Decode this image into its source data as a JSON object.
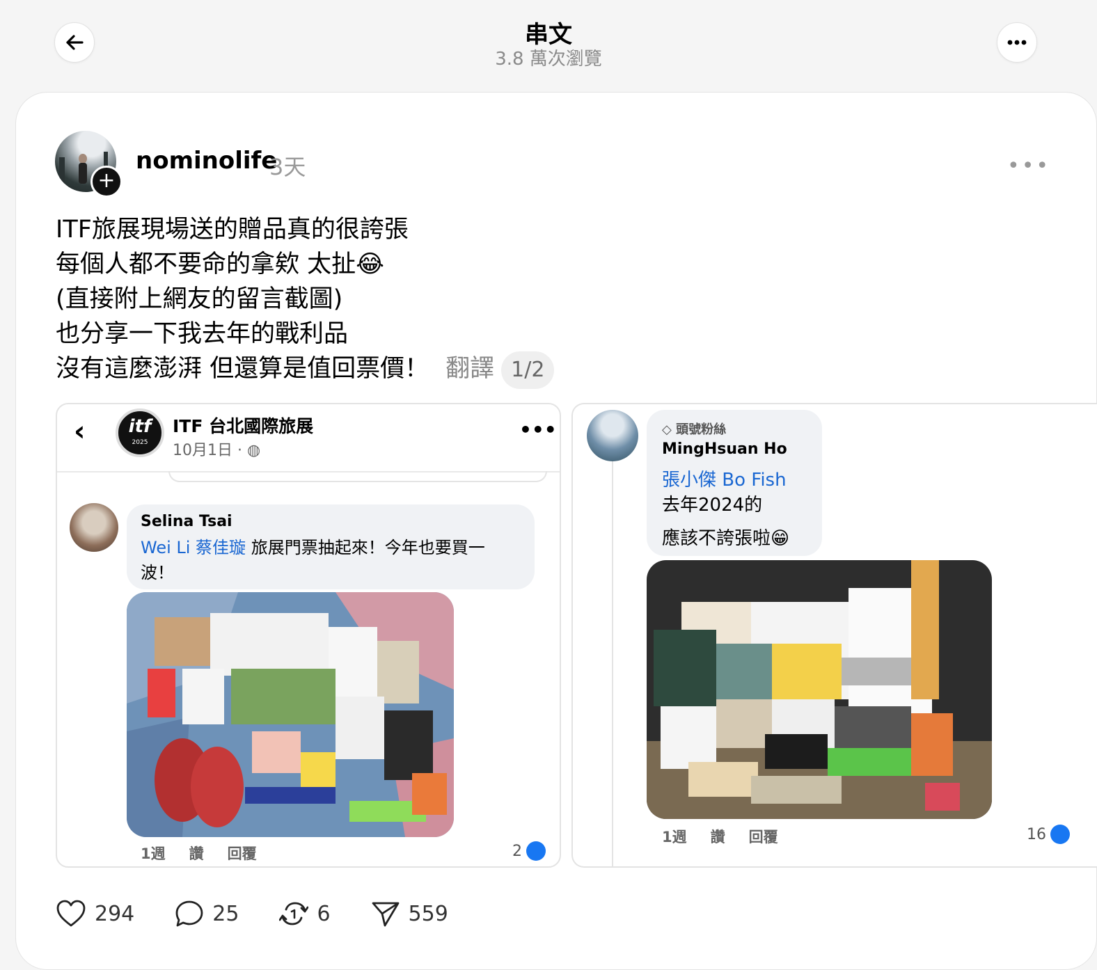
{
  "header": {
    "title": "串文",
    "views": "3.8 萬次瀏覽"
  },
  "post": {
    "username": "nominolife",
    "time": "3天",
    "lines": [
      "ITF旅展現場送的贈品真的很誇張",
      "每個人都不要命的拿欸 太扯😂",
      "(直接附上網友的留言截圖)",
      "也分享一下我去年的戰利品",
      "沒有這麼澎湃 但還算是值回票價！"
    ],
    "translate": "翻譯",
    "pager": "1/2"
  },
  "left_shot": {
    "page_name": "ITF 台北國際旅展",
    "logo_text": "itf",
    "logo_year": "2025",
    "date": "10月1日 ·",
    "comment": {
      "name": "Selina Tsai",
      "mention": "Wei Li 蔡佳璇",
      "text1": " 旅展門票抽起來！今年也要買一",
      "text2": "波！"
    },
    "actions": [
      "1週",
      "讚",
      "回覆"
    ],
    "likes": "2"
  },
  "right_shot": {
    "badge": "頭號粉絲",
    "name": "MingHsuan Ho",
    "mention": "張小傑 Bo Fish",
    "line1": "去年2024的",
    "line2": "應該不誇張啦😁",
    "actions": [
      "1週",
      "讚",
      "回覆"
    ],
    "likes": "16"
  },
  "stats": {
    "likes": "294",
    "comments": "25",
    "reposts": "6",
    "shares": "559"
  }
}
